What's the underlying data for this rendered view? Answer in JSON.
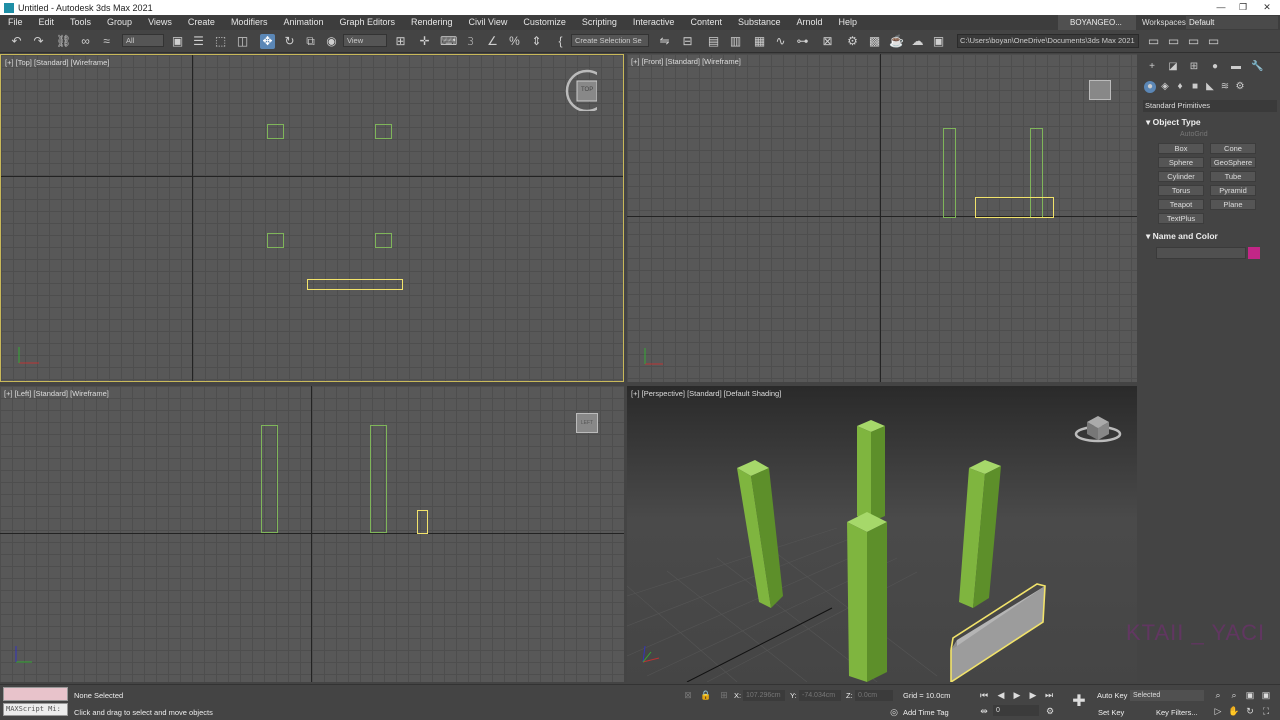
{
  "window": {
    "title": "Untitled - Autodesk 3ds Max 2021"
  },
  "menu": [
    "File",
    "Edit",
    "Tools",
    "Group",
    "Views",
    "Create",
    "Modifiers",
    "Animation",
    "Graph Editors",
    "Rendering",
    "Civil View",
    "Customize",
    "Scripting",
    "Interactive",
    "Content",
    "Substance",
    "Arnold",
    "Help"
  ],
  "user": {
    "name": "BOYANGEO...",
    "workspaces_label": "Workspaces:",
    "workspace": "Default"
  },
  "toolbar": {
    "filter": "All",
    "coord_system": "View",
    "selection_set": "Create Selection Se",
    "project_path": "C:\\Users\\boyan\\OneDrive\\Documents\\3ds Max 2021"
  },
  "viewports": {
    "top": {
      "label": "[+] [Top] [Standard] [Wireframe]",
      "cube": "TOP"
    },
    "front": {
      "label": "[+] [Front] [Standard] [Wireframe]"
    },
    "left": {
      "label": "[+] [Left] [Standard] [Wireframe]",
      "cube": "LEFT"
    },
    "persp": {
      "label": "[+] [Perspective] [Standard] [Default Shading]"
    }
  },
  "command_panel": {
    "category": "Standard Primitives",
    "object_type_title": "Object Type",
    "autogrid": "AutoGrid",
    "buttons": [
      "Box",
      "Cone",
      "Sphere",
      "GeoSphere",
      "Cylinder",
      "Tube",
      "Torus",
      "Pyramid",
      "Teapot",
      "Plane",
      "TextPlus"
    ],
    "name_color_title": "Name and Color",
    "object_color": "#c32687"
  },
  "status": {
    "maxscript": "MAXScript Mi:",
    "selection": "None Selected",
    "prompt": "Click and drag to select and move objects",
    "x_label": "X:",
    "x": "107.296cm",
    "y_label": "Y:",
    "y": "-74.034cm",
    "z_label": "Z:",
    "z": "0.0cm",
    "grid": "Grid = 10.0cm",
    "add_time_tag": "Add Time Tag",
    "auto_key": "Auto Key",
    "set_key": "Set Key",
    "key_mode": "Selected",
    "frame": "0",
    "key_filters": "Key Filters..."
  },
  "watermark": "KTAII _ YACI"
}
